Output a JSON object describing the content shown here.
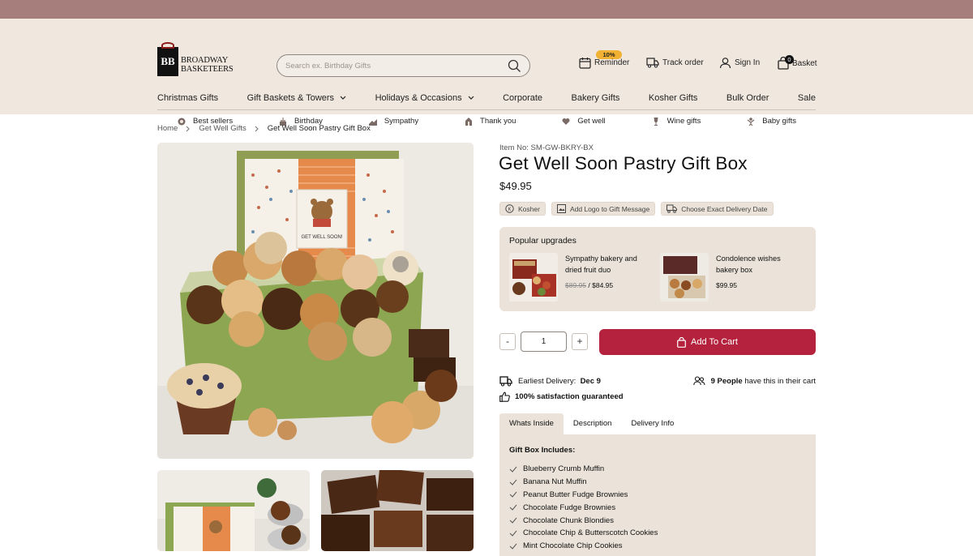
{
  "header": {
    "logo_line1": "BROADWAY",
    "logo_line2": "BASKETEERS",
    "logo_mark": "BB",
    "search_placeholder": "Search ex. Birthday Gifts",
    "reminder_badge": "10%",
    "reminder": "Reminder",
    "track": "Track order",
    "signin": "Sign In",
    "basket": "Basket",
    "basket_count": "0"
  },
  "nav": [
    "Christmas Gifts",
    "Gift Baskets & Towers",
    "Holidays & Occasions",
    "Corporate",
    "Bakery Gifts",
    "Kosher Gifts",
    "Bulk Order",
    "Sale"
  ],
  "subnav": [
    "Best sellers",
    "Birthday",
    "Sympathy",
    "Thank you",
    "Get well",
    "Wine gifts",
    "Baby gifts"
  ],
  "breadcrumb": [
    "Home",
    "Get Well Gifts",
    "Get Well Soon Pastry Gift Box"
  ],
  "product": {
    "item_no": "Item No: SM-GW-BKRY-BX",
    "title": "Get Well Soon Pastry Gift Box",
    "price": "$49.95",
    "chips": [
      "Kosher",
      "Add Logo to Gift Message",
      "Choose Exact Delivery Date"
    ],
    "box_card_text": "GET WELL SOON!",
    "box_card_small": "I CARE FOR YOU"
  },
  "upgrades": {
    "heading": "Popular upgrades",
    "items": [
      {
        "name_line1": "Sympathy bakery and",
        "name_line2": "dried fruit duo",
        "old_price": "$89.95",
        "sep": "/",
        "price": "$84.95"
      },
      {
        "name_line1": "Condolence wishes",
        "name_line2": "bakery box",
        "price": "$99.95"
      }
    ]
  },
  "cart": {
    "minus": "-",
    "qty": "1",
    "plus": "+",
    "add_label": "Add To Cart"
  },
  "info": {
    "earliest_label": "Earliest Delivery:",
    "earliest_date": "Dec 9",
    "people_count": "9 People",
    "people_text": "have this in their cart",
    "guarantee": "100% satisfaction guaranteed"
  },
  "tabs": [
    "Whats Inside",
    "Description",
    "Delivery Info"
  ],
  "contents": {
    "heading": "Gift Box Includes:",
    "items": [
      "Blueberry Crumb Muffin",
      "Banana Nut Muffin",
      "Peanut Butter Fudge Brownies",
      "Chocolate Fudge Brownies",
      "Chocolate Chunk Blondies",
      "Chocolate Chip & Butterscotch Cookies",
      "Mint Chocolate Chip Cookies"
    ]
  },
  "colors": {
    "topbar": "#a67f7c",
    "header_bg": "#f0e7de",
    "panel_bg": "#ebe3d9",
    "cart_button": "#b5223d",
    "badge": "#f1b132"
  }
}
